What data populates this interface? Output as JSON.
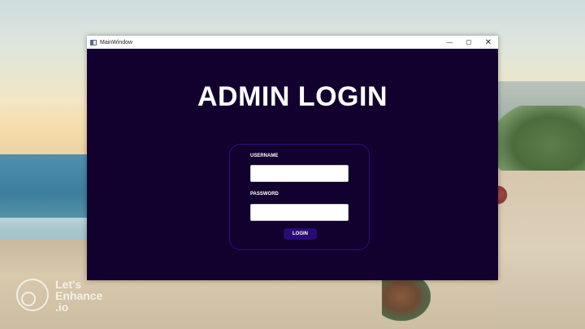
{
  "window": {
    "title": "MainWindow",
    "controls": {
      "minimize_icon": "minimize-icon",
      "maximize_icon": "maximize-icon",
      "close_label": "✕"
    }
  },
  "login": {
    "heading": "ADMIN LOGIN",
    "username_label": "USERNAME",
    "username_value": "",
    "password_label": "PASSWORD",
    "password_value": "",
    "button_label": "LOGIN"
  },
  "wallpaper": {
    "watermark_text": "Let's Enhance .io"
  },
  "colors": {
    "window_bg": "#12002e",
    "panel_border": "#2a1080",
    "button_bg": "#2a0a78",
    "text": "#ffffff"
  }
}
